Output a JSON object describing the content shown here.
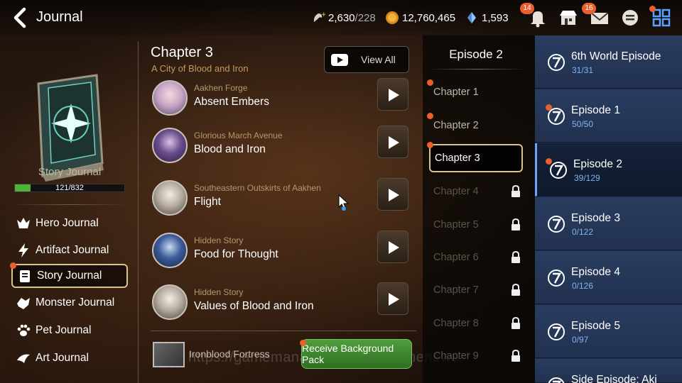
{
  "header": {
    "title": "Journal",
    "resources": [
      {
        "icon": "stamina-icon",
        "value": "2,630",
        "max": "/228"
      },
      {
        "icon": "gold-icon",
        "value": "12,760,465",
        "max": ""
      },
      {
        "icon": "skystone-icon",
        "value": "1,593",
        "max": ""
      }
    ],
    "notifications_badge": "14",
    "mail_badge": "16"
  },
  "left": {
    "journal_name": "Story Journal",
    "progress_text": "121/832",
    "progress_fraction": 0.145,
    "menu": [
      {
        "label": "Hero Journal",
        "icon": "hero-journal-icon"
      },
      {
        "label": "Artifact Journal",
        "icon": "artifact-journal-icon"
      },
      {
        "label": "Story Journal",
        "icon": "story-journal-icon"
      },
      {
        "label": "Monster Journal",
        "icon": "monster-journal-icon"
      },
      {
        "label": "Pet Journal",
        "icon": "paw-icon"
      },
      {
        "label": "Art Journal",
        "icon": "art-journal-icon"
      }
    ]
  },
  "main": {
    "chapter_title": "Chapter 3",
    "chapter_subtitle": "A City of Blood and Iron",
    "view_all": "View All",
    "stories": [
      {
        "location": "Aakhen Forge",
        "title": "Absent Embers"
      },
      {
        "location": "Glorious March Avenue",
        "title": "Blood and Iron"
      },
      {
        "location": "Southeastern Outskirts of Aakhen",
        "title": "Flight"
      },
      {
        "location": "Hidden Story",
        "title": "Food for Thought"
      },
      {
        "location": "Hidden Story",
        "title": "Values of Blood and Iron"
      }
    ],
    "background_name": "Ironblood Fortress",
    "receive_label": "Receive Background Pack",
    "watermark": "https://gamemanaeng...news/Gamenews"
  },
  "chapters": {
    "header": "Episode 2",
    "items": [
      {
        "label": "Chapter 1",
        "locked": false
      },
      {
        "label": "Chapter 2",
        "locked": false
      },
      {
        "label": "Chapter 3",
        "locked": false
      },
      {
        "label": "Chapter 4",
        "locked": true
      },
      {
        "label": "Chapter 5",
        "locked": true
      },
      {
        "label": "Chapter 6",
        "locked": true
      },
      {
        "label": "Chapter 7",
        "locked": true
      },
      {
        "label": "Chapter 8",
        "locked": true
      },
      {
        "label": "Chapter 9",
        "locked": true
      }
    ]
  },
  "episodes": [
    {
      "name": "6th World Episode",
      "count": "31/31"
    },
    {
      "name": "Episode 1",
      "count": "50/50"
    },
    {
      "name": "Episode 2",
      "count": "39/129"
    },
    {
      "name": "Episode 3",
      "count": "0/122"
    },
    {
      "name": "Episode 4",
      "count": "0/126"
    },
    {
      "name": "Episode 5",
      "count": "0/97"
    },
    {
      "name": "Side Episode: Aki",
      "count": ""
    }
  ],
  "colors": {
    "accent_gold": "#d9c48e",
    "alert_orange": "#e9602e",
    "episode_blue": "#21314f",
    "progress_green": "#4fb13a"
  }
}
